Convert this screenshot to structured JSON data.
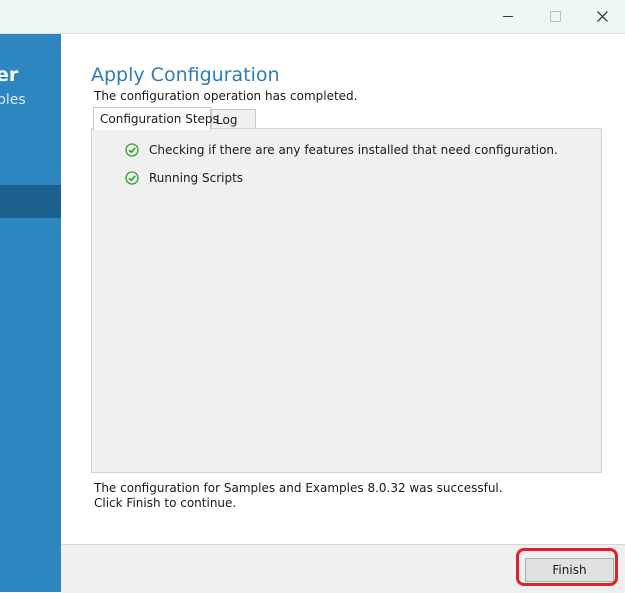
{
  "window": {
    "controls": {
      "minimize": "minimize-icon",
      "maximize": "maximize-icon",
      "close": "close-icon"
    }
  },
  "sidebar": {
    "title_fragment": "er",
    "subtitle_fragment": "ples"
  },
  "main": {
    "heading": "Apply Configuration",
    "status": "The configuration operation has completed.",
    "tabs": [
      {
        "label": "Configuration Steps",
        "active": true
      },
      {
        "label": "Log",
        "active": false
      }
    ],
    "steps": [
      {
        "label": "Checking if there are any features installed that need configuration.",
        "icon": "check-circle-icon",
        "status": "done"
      },
      {
        "label": "Running Scripts",
        "icon": "check-circle-icon",
        "status": "done"
      }
    ],
    "result_line1": "The configuration for Samples and Examples 8.0.32 was successful.",
    "result_line2": "Click Finish to continue."
  },
  "footer": {
    "finish_label": "Finish"
  },
  "colors": {
    "accent": "#2d86c0",
    "sidebar_selected": "#1c618e",
    "heading": "#2e7cb8",
    "check": "#3a9a3a",
    "highlight": "#e0202a"
  }
}
